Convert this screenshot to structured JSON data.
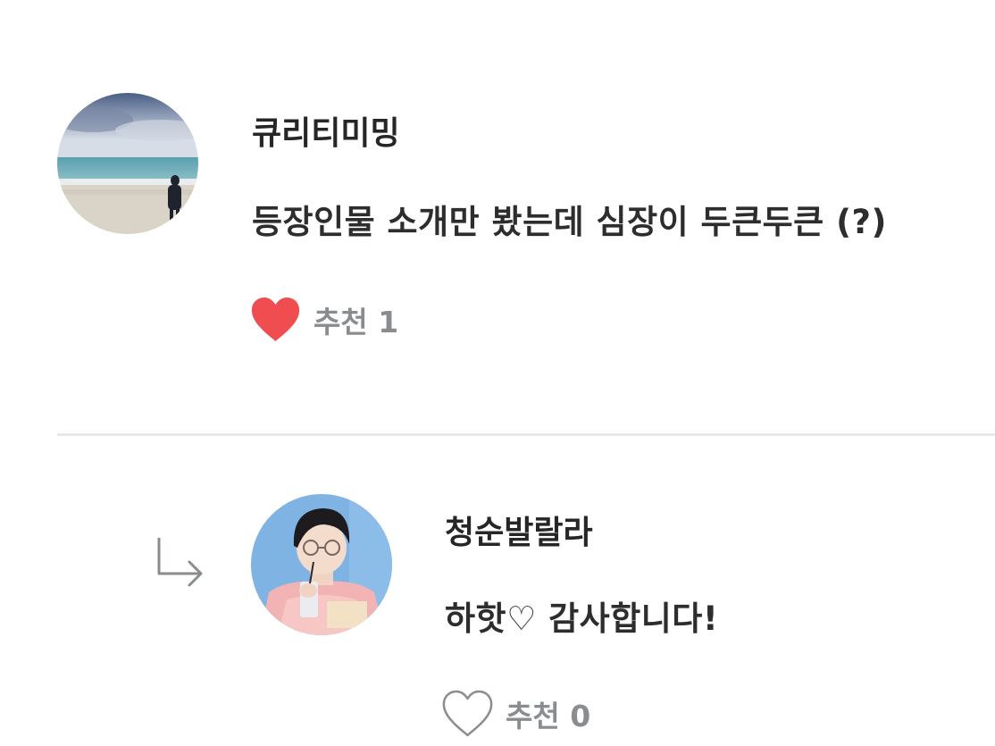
{
  "comments": [
    {
      "username": "큐리티미밍",
      "text": "등장인물 소개만 봤는데 심장이 두큰두큰 (?)",
      "like_label": "추천",
      "like_count": "1",
      "liked": true,
      "heart_icon": "heart-filled-icon"
    }
  ],
  "replies": [
    {
      "username": "청순발랄라",
      "text": "하핫♡ 감사합니다!",
      "like_label": "추천",
      "like_count": "0",
      "liked": false,
      "heart_icon": "heart-outline-icon",
      "reply_icon": "reply-arrow-icon"
    }
  ],
  "colors": {
    "heart_filled": "#ef4d4f",
    "heart_outline": "#8a8d90",
    "divider": "#e6e9ea",
    "muted_text": "#8a8d90"
  }
}
